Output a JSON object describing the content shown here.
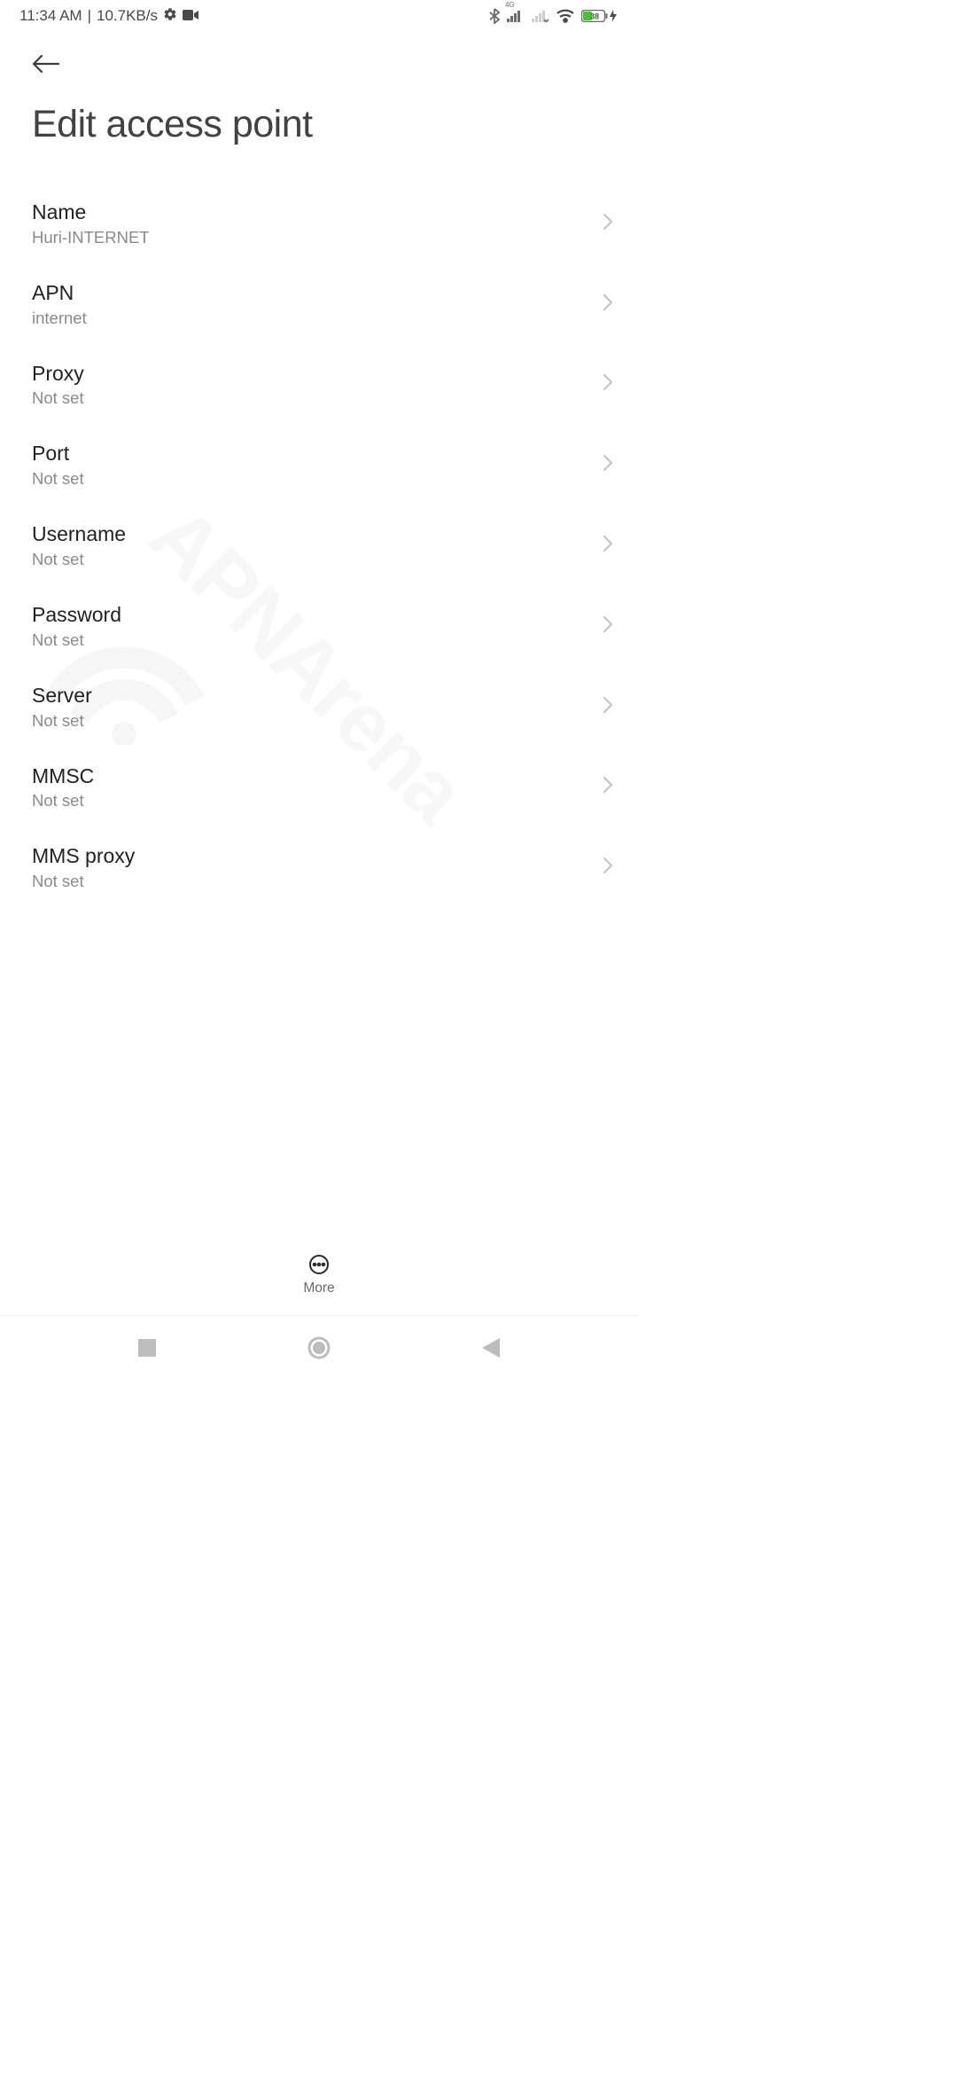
{
  "status_bar": {
    "time": "11:34 AM",
    "separator": "|",
    "net_speed": "10.7KB/s",
    "network_tag": "4G",
    "battery_pct": "38"
  },
  "header": {
    "title": "Edit access point"
  },
  "settings": [
    {
      "label": "Name",
      "value": "Huri-INTERNET"
    },
    {
      "label": "APN",
      "value": "internet"
    },
    {
      "label": "Proxy",
      "value": "Not set"
    },
    {
      "label": "Port",
      "value": "Not set"
    },
    {
      "label": "Username",
      "value": "Not set"
    },
    {
      "label": "Password",
      "value": "Not set"
    },
    {
      "label": "Server",
      "value": "Not set"
    },
    {
      "label": "MMSC",
      "value": "Not set"
    },
    {
      "label": "MMS proxy",
      "value": "Not set"
    }
  ],
  "bottom": {
    "more_label": "More"
  },
  "watermark_text": "APNArena"
}
